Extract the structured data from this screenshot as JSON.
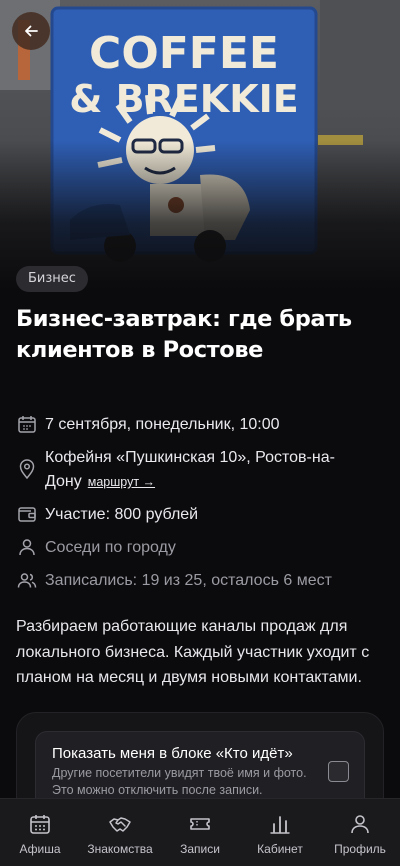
{
  "header": {
    "back_icon": "arrow-left-icon",
    "photo": {
      "sign_line1": "COFFEE",
      "sign_line2": "& BREKKIE"
    }
  },
  "event": {
    "category": "Бизнес",
    "title": "Бизнес-завтрак: где брать клиентов в Ростове",
    "date": "7 сентября, понедельник, 10:00",
    "location": "Кофейня «Пушкинская 10», Ростов-на-Дону",
    "route_label": "маршрут →",
    "price": "Участие: 800 рублей",
    "audience": "Соседи по городу",
    "attendance": "Записались: 19 из 25, осталось 6 мест",
    "description": "Разбираем работающие каналы продаж для локального бизнеса. Каждый участник уходит с планом на месяц и двумя новыми контактами."
  },
  "visibility_card": {
    "title": "Показать меня в блоке «Кто идёт»",
    "description": "Другие посетители увидят твоё имя и фото. Это можно отключить после записи.",
    "checked": false
  },
  "tabbar": {
    "items": [
      {
        "label": "Афиша",
        "icon": "calendar-icon"
      },
      {
        "label": "Знакомства",
        "icon": "handshake-icon"
      },
      {
        "label": "Записи",
        "icon": "ticket-icon"
      },
      {
        "label": "Кабинет",
        "icon": "chart-icon"
      },
      {
        "label": "Профиль",
        "icon": "user-icon"
      }
    ]
  },
  "colors": {
    "background": "#0b0b0d",
    "sign_blue": "#2f5fb5",
    "back_button": "#462e22",
    "tabbar": "#1a1a1d"
  }
}
